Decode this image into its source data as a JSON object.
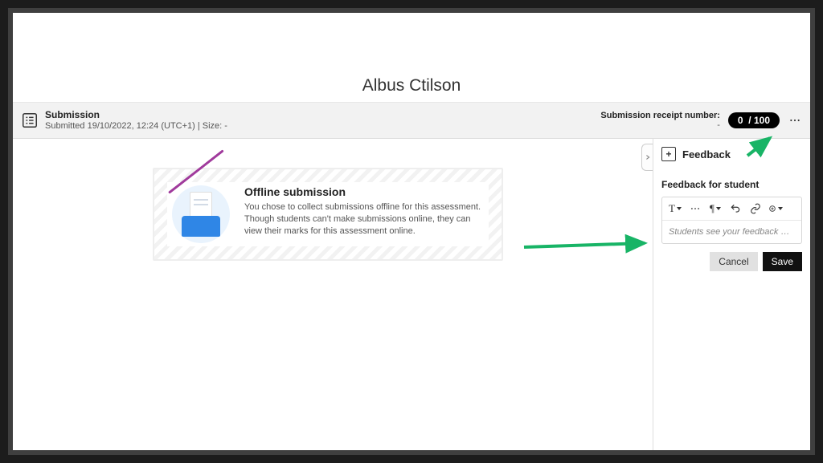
{
  "student_name": "Albus Ctilson",
  "submission": {
    "title": "Submission",
    "meta": "Submitted 19/10/2022, 12:24 (UTC+1) | Size: -"
  },
  "receipt": {
    "label": "Submission receipt number:",
    "value": "-"
  },
  "score": {
    "got": "0",
    "sep": "/",
    "out_of": "100"
  },
  "offline": {
    "heading": "Offline submission",
    "body": "You chose to collect submissions offline for this assessment. Though students can't make submissions online, they can view their marks for this assessment online."
  },
  "feedback_panel": {
    "header": "Feedback",
    "subheader": "Feedback for student",
    "placeholder": "Students see your feedback when you post ma…",
    "cancel": "Cancel",
    "save": "Save"
  },
  "toolbar_icons": [
    "text-style",
    "more-formatting",
    "paragraph",
    "undo",
    "link",
    "insert-plus"
  ],
  "colors": {
    "accent_green": "#18b466",
    "pill_bg": "#000000"
  }
}
